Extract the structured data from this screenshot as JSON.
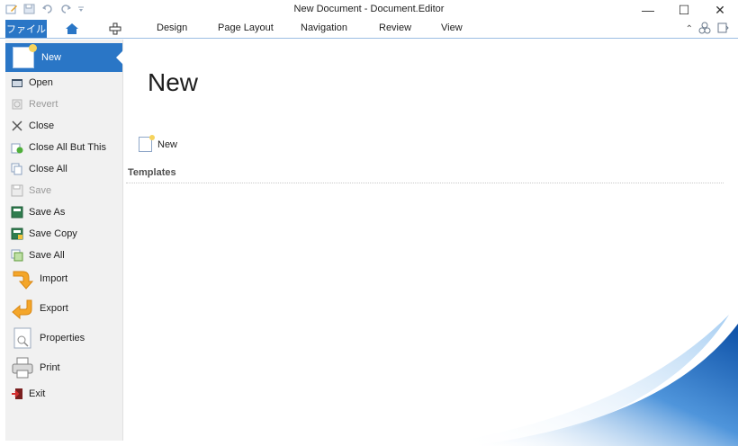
{
  "window": {
    "title": "New Document - Document.Editor",
    "controls": [
      "minimize-icon",
      "maximize-icon",
      "close-icon"
    ]
  },
  "ribbon": {
    "file_tab": "ファイル",
    "tabs": [
      "Design",
      "Page Layout",
      "Navigation",
      "Review",
      "View"
    ]
  },
  "backstage": {
    "selected": "New",
    "items": [
      {
        "label": "Open",
        "enabled": true,
        "icon": "open-folder-icon"
      },
      {
        "label": "Revert",
        "enabled": false,
        "icon": "revert-icon"
      },
      {
        "label": "Close",
        "enabled": true,
        "icon": "close-x-icon"
      },
      {
        "label": "Close All But This",
        "enabled": true,
        "icon": "close-others-icon"
      },
      {
        "label": "Close All",
        "enabled": true,
        "icon": "close-all-icon"
      },
      {
        "label": "Save",
        "enabled": false,
        "icon": "save-icon"
      },
      {
        "label": "Save As",
        "enabled": true,
        "icon": "save-as-icon"
      },
      {
        "label": "Save Copy",
        "enabled": true,
        "icon": "save-copy-icon"
      },
      {
        "label": "Save All",
        "enabled": true,
        "icon": "save-all-icon"
      }
    ],
    "big_items": [
      {
        "label": "Import",
        "icon": "import-arrow-icon"
      },
      {
        "label": "Export",
        "icon": "export-arrow-icon"
      },
      {
        "label": "Properties",
        "icon": "properties-icon"
      },
      {
        "label": "Print",
        "icon": "printer-icon"
      }
    ],
    "exit": {
      "label": "Exit",
      "icon": "exit-icon"
    }
  },
  "main": {
    "heading": "New",
    "new_link": "New",
    "templates_label": "Templates"
  },
  "colors": {
    "accent": "#2a76c6",
    "nav_bg": "#f1f1f1"
  }
}
